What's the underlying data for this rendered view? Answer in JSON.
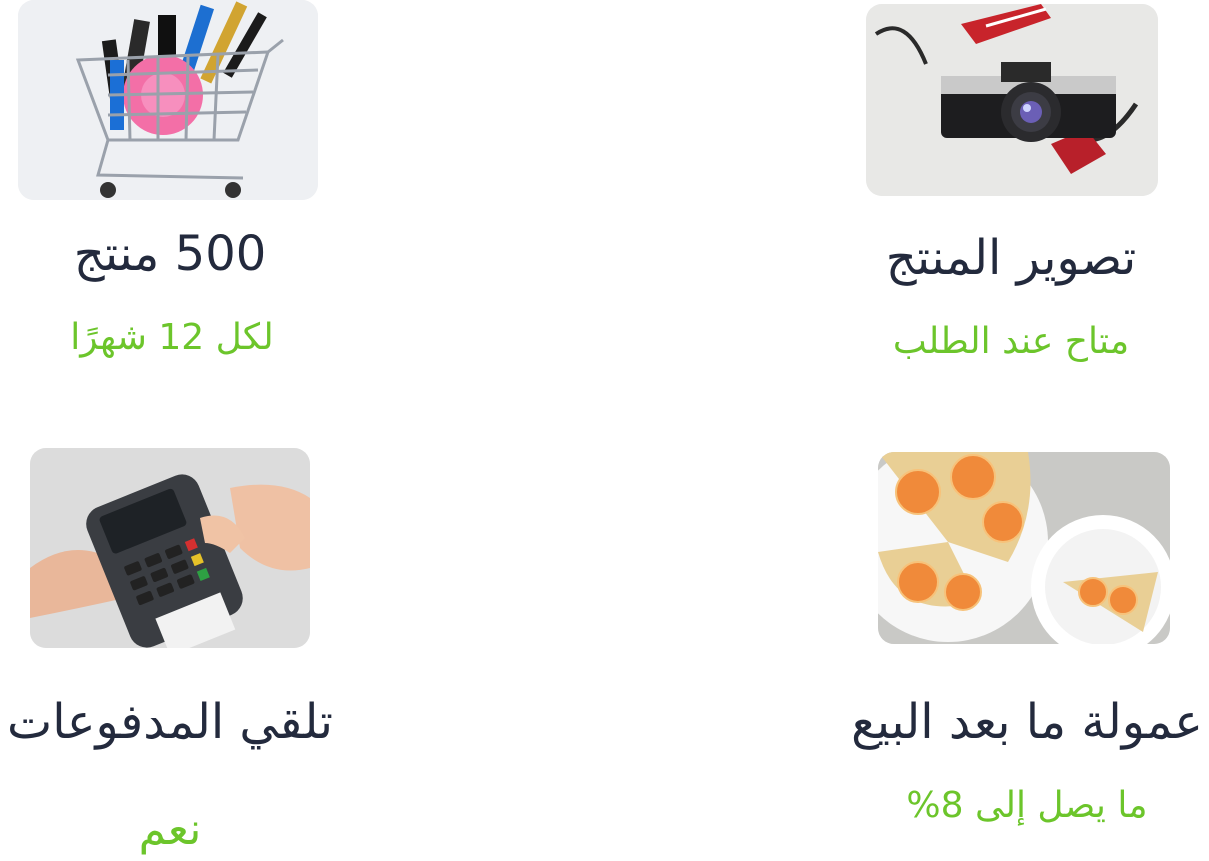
{
  "features": [
    {
      "title": "500 منتج",
      "subtitle": "لكل 12 شهرًا",
      "image_icon": "shopping-cart-cosmetics-photo"
    },
    {
      "title": "تصوير المنتج",
      "subtitle": "متاح عند الطلب",
      "image_icon": "camera-photo"
    },
    {
      "title": "تلقي المدفوعات",
      "subtitle": "نعم",
      "image_icon": "card-payment-terminal-photo"
    },
    {
      "title": "عمولة ما بعد البيع",
      "subtitle": "ما يصل إلى 8%",
      "image_icon": "tart-dessert-photo"
    }
  ],
  "colors": {
    "title": "#232a3d",
    "subtitle": "#6cc52b"
  }
}
